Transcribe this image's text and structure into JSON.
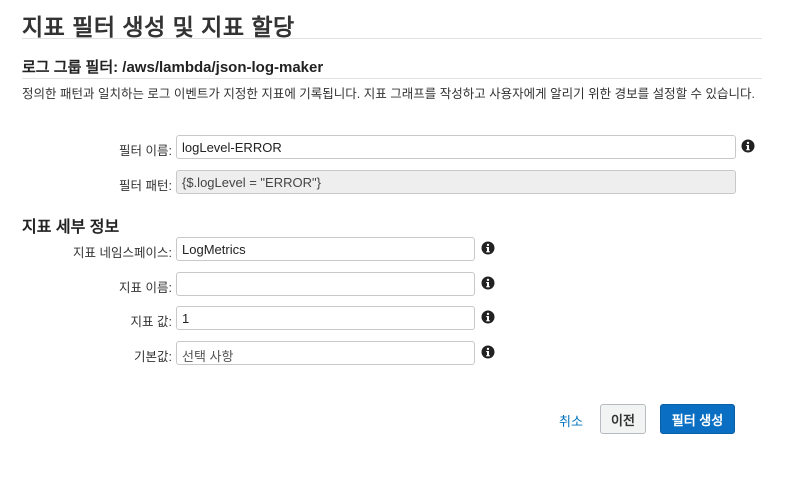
{
  "page": {
    "title": "지표 필터 생성 및 지표 할당"
  },
  "log_group": {
    "heading": "로그 그룹 필터: /aws/lambda/json-log-maker",
    "description": "정의한 패턴과 일치하는 로그 이벤트가 지정한 지표에 기록됩니다. 지표 그래프를 작성하고 사용자에게 알리기 위한 경보를 설정할 수 있습니다."
  },
  "filter": {
    "name_label": "필터 이름:",
    "name_value": "logLevel-ERROR",
    "pattern_label": "필터 패턴:",
    "pattern_value": "{$.logLevel = \"ERROR\"}"
  },
  "metric": {
    "heading": "지표 세부 정보",
    "namespace_label": "지표 네임스페이스:",
    "namespace_value": "LogMetrics",
    "name_label": "지표 이름:",
    "name_value": "",
    "value_label": "지표 값:",
    "value_value": "1",
    "default_label": "기본값:",
    "default_placeholder": "선택 사항"
  },
  "actions": {
    "cancel": "취소",
    "previous": "이전",
    "create": "필터 생성"
  },
  "icons": {
    "info": "info-icon"
  },
  "colors": {
    "primary": "#0a6fc2",
    "link": "#0073bb"
  }
}
